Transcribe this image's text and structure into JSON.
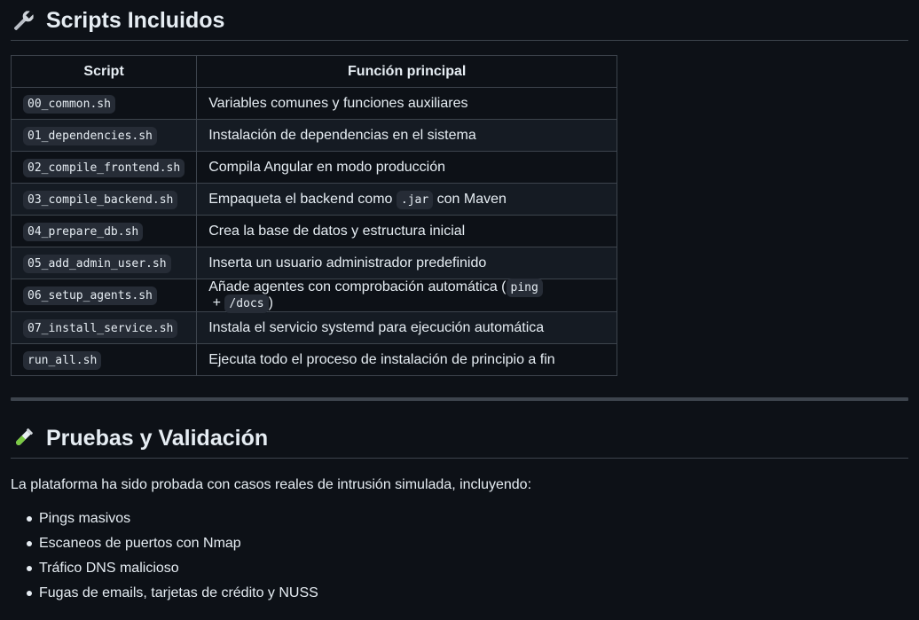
{
  "section_scripts": {
    "icon": "wrench-icon",
    "title": "Scripts Incluidos"
  },
  "table": {
    "headers": [
      "Script",
      "Función principal"
    ],
    "rows": [
      {
        "script": "00_common.sh",
        "parts": [
          {
            "t": "Variables comunes y funciones auxiliares"
          }
        ]
      },
      {
        "script": "01_dependencies.sh",
        "parts": [
          {
            "t": "Instalación de dependencias en el sistema"
          }
        ]
      },
      {
        "script": "02_compile_frontend.sh",
        "parts": [
          {
            "t": "Compila Angular en modo producción"
          }
        ]
      },
      {
        "script": "03_compile_backend.sh",
        "parts": [
          {
            "t": "Empaqueta el backend como "
          },
          {
            "c": ".jar"
          },
          {
            "t": " con Maven"
          }
        ]
      },
      {
        "script": "04_prepare_db.sh",
        "parts": [
          {
            "t": "Crea la base de datos y estructura inicial"
          }
        ]
      },
      {
        "script": "05_add_admin_user.sh",
        "parts": [
          {
            "t": "Inserta un usuario administrador predefinido"
          }
        ]
      },
      {
        "script": "06_setup_agents.sh",
        "parts": [
          {
            "t": "Añade agentes con comprobación automática ("
          },
          {
            "c": "ping"
          },
          {
            "t": " + "
          },
          {
            "c": "/docs"
          },
          {
            "t": ")"
          }
        ]
      },
      {
        "script": "07_install_service.sh",
        "parts": [
          {
            "t": "Instala el servicio systemd para ejecución automática"
          }
        ]
      },
      {
        "script": "run_all.sh",
        "parts": [
          {
            "t": "Ejecuta todo el proceso de instalación de principio a fin"
          }
        ]
      }
    ]
  },
  "section_pruebas": {
    "icon": "test-tube-icon",
    "title": "Pruebas y Validación",
    "intro": "La plataforma ha sido probada con casos reales de intrusión simulada, incluyendo:",
    "items": [
      "Pings masivos",
      "Escaneos de puertos con Nmap",
      "Tráfico DNS malicioso",
      "Fugas de emails, tarjetas de crédito y NUSS"
    ]
  },
  "colors": {
    "background": "#0d1117",
    "text": "#e6edf3",
    "border": "#3d444d",
    "row_alt": "#151b23",
    "code_bg": "#262c36"
  }
}
